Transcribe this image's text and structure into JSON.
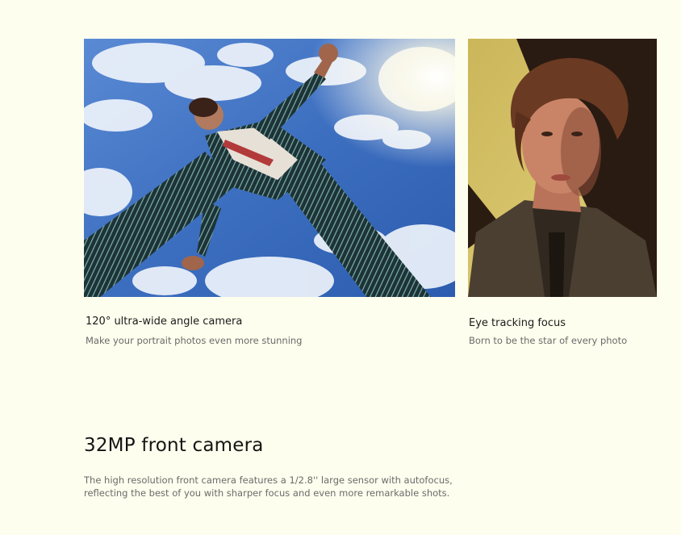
{
  "features": [
    {
      "title": "120° ultra-wide angle camera",
      "subtitle": "Make your portrait photos even more stunning"
    },
    {
      "title": "Eye tracking focus",
      "subtitle": "Born to be the star of every photo"
    }
  ],
  "section": {
    "heading": "32MP front camera",
    "body_lines": [
      "The high resolution front camera features a 1/2.8'' large sensor with autofocus,",
      "reflecting the best of you with sharper focus and even more remarkable shots."
    ]
  },
  "colors": {
    "page_background": "#fefeee",
    "sky_blue": "#3f73c4",
    "portrait_yellow": "#d8c56a"
  }
}
